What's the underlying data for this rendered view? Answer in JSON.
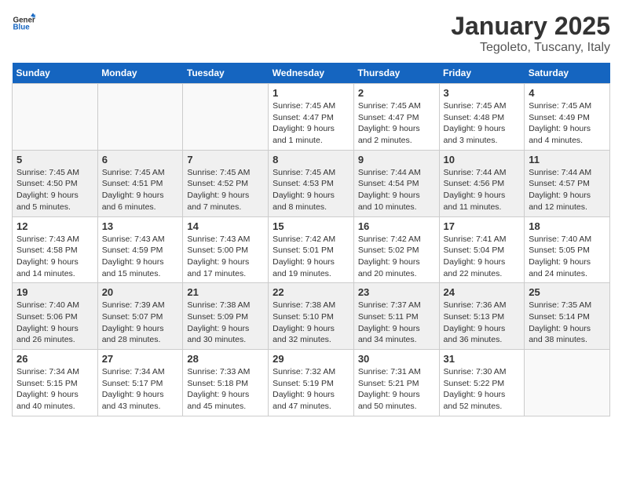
{
  "header": {
    "logo_general": "General",
    "logo_blue": "Blue",
    "month": "January 2025",
    "location": "Tegoleto, Tuscany, Italy"
  },
  "days_of_week": [
    "Sunday",
    "Monday",
    "Tuesday",
    "Wednesday",
    "Thursday",
    "Friday",
    "Saturday"
  ],
  "weeks": [
    [
      {
        "num": "",
        "info": ""
      },
      {
        "num": "",
        "info": ""
      },
      {
        "num": "",
        "info": ""
      },
      {
        "num": "1",
        "info": "Sunrise: 7:45 AM\nSunset: 4:47 PM\nDaylight: 9 hours and 1 minute."
      },
      {
        "num": "2",
        "info": "Sunrise: 7:45 AM\nSunset: 4:47 PM\nDaylight: 9 hours and 2 minutes."
      },
      {
        "num": "3",
        "info": "Sunrise: 7:45 AM\nSunset: 4:48 PM\nDaylight: 9 hours and 3 minutes."
      },
      {
        "num": "4",
        "info": "Sunrise: 7:45 AM\nSunset: 4:49 PM\nDaylight: 9 hours and 4 minutes."
      }
    ],
    [
      {
        "num": "5",
        "info": "Sunrise: 7:45 AM\nSunset: 4:50 PM\nDaylight: 9 hours and 5 minutes."
      },
      {
        "num": "6",
        "info": "Sunrise: 7:45 AM\nSunset: 4:51 PM\nDaylight: 9 hours and 6 minutes."
      },
      {
        "num": "7",
        "info": "Sunrise: 7:45 AM\nSunset: 4:52 PM\nDaylight: 9 hours and 7 minutes."
      },
      {
        "num": "8",
        "info": "Sunrise: 7:45 AM\nSunset: 4:53 PM\nDaylight: 9 hours and 8 minutes."
      },
      {
        "num": "9",
        "info": "Sunrise: 7:44 AM\nSunset: 4:54 PM\nDaylight: 9 hours and 10 minutes."
      },
      {
        "num": "10",
        "info": "Sunrise: 7:44 AM\nSunset: 4:56 PM\nDaylight: 9 hours and 11 minutes."
      },
      {
        "num": "11",
        "info": "Sunrise: 7:44 AM\nSunset: 4:57 PM\nDaylight: 9 hours and 12 minutes."
      }
    ],
    [
      {
        "num": "12",
        "info": "Sunrise: 7:43 AM\nSunset: 4:58 PM\nDaylight: 9 hours and 14 minutes."
      },
      {
        "num": "13",
        "info": "Sunrise: 7:43 AM\nSunset: 4:59 PM\nDaylight: 9 hours and 15 minutes."
      },
      {
        "num": "14",
        "info": "Sunrise: 7:43 AM\nSunset: 5:00 PM\nDaylight: 9 hours and 17 minutes."
      },
      {
        "num": "15",
        "info": "Sunrise: 7:42 AM\nSunset: 5:01 PM\nDaylight: 9 hours and 19 minutes."
      },
      {
        "num": "16",
        "info": "Sunrise: 7:42 AM\nSunset: 5:02 PM\nDaylight: 9 hours and 20 minutes."
      },
      {
        "num": "17",
        "info": "Sunrise: 7:41 AM\nSunset: 5:04 PM\nDaylight: 9 hours and 22 minutes."
      },
      {
        "num": "18",
        "info": "Sunrise: 7:40 AM\nSunset: 5:05 PM\nDaylight: 9 hours and 24 minutes."
      }
    ],
    [
      {
        "num": "19",
        "info": "Sunrise: 7:40 AM\nSunset: 5:06 PM\nDaylight: 9 hours and 26 minutes."
      },
      {
        "num": "20",
        "info": "Sunrise: 7:39 AM\nSunset: 5:07 PM\nDaylight: 9 hours and 28 minutes."
      },
      {
        "num": "21",
        "info": "Sunrise: 7:38 AM\nSunset: 5:09 PM\nDaylight: 9 hours and 30 minutes."
      },
      {
        "num": "22",
        "info": "Sunrise: 7:38 AM\nSunset: 5:10 PM\nDaylight: 9 hours and 32 minutes."
      },
      {
        "num": "23",
        "info": "Sunrise: 7:37 AM\nSunset: 5:11 PM\nDaylight: 9 hours and 34 minutes."
      },
      {
        "num": "24",
        "info": "Sunrise: 7:36 AM\nSunset: 5:13 PM\nDaylight: 9 hours and 36 minutes."
      },
      {
        "num": "25",
        "info": "Sunrise: 7:35 AM\nSunset: 5:14 PM\nDaylight: 9 hours and 38 minutes."
      }
    ],
    [
      {
        "num": "26",
        "info": "Sunrise: 7:34 AM\nSunset: 5:15 PM\nDaylight: 9 hours and 40 minutes."
      },
      {
        "num": "27",
        "info": "Sunrise: 7:34 AM\nSunset: 5:17 PM\nDaylight: 9 hours and 43 minutes."
      },
      {
        "num": "28",
        "info": "Sunrise: 7:33 AM\nSunset: 5:18 PM\nDaylight: 9 hours and 45 minutes."
      },
      {
        "num": "29",
        "info": "Sunrise: 7:32 AM\nSunset: 5:19 PM\nDaylight: 9 hours and 47 minutes."
      },
      {
        "num": "30",
        "info": "Sunrise: 7:31 AM\nSunset: 5:21 PM\nDaylight: 9 hours and 50 minutes."
      },
      {
        "num": "31",
        "info": "Sunrise: 7:30 AM\nSunset: 5:22 PM\nDaylight: 9 hours and 52 minutes."
      },
      {
        "num": "",
        "info": ""
      }
    ]
  ]
}
